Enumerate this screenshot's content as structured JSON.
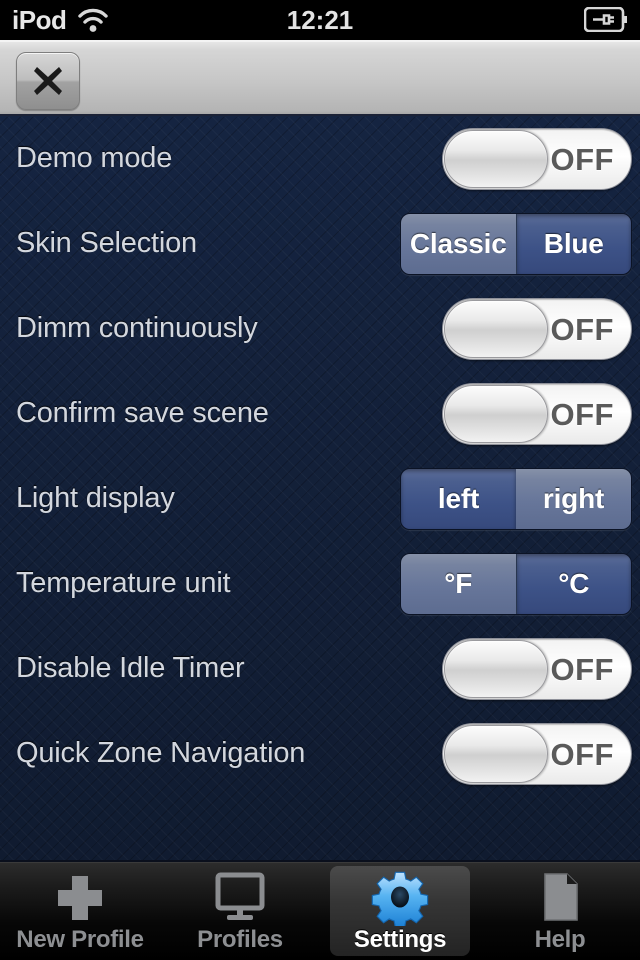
{
  "statusbar": {
    "carrier": "iPod",
    "wifi_icon": "wifi-icon",
    "time": "12:21",
    "battery_icon": "battery-charging-icon"
  },
  "toolbar": {
    "close_icon": "close-x-icon",
    "close_label": ""
  },
  "theme": {
    "background": "#142038",
    "accent_selected": "#3d5287",
    "accent_unselected": "#67769a",
    "label_color": "#d3d7de",
    "tab_selected_color": "#ffffff",
    "tab_icon_gear_color": "#3fa9f5"
  },
  "settings": {
    "rows": [
      {
        "label": "Demo mode",
        "control": "switch",
        "value": "OFF"
      },
      {
        "label": "Skin Selection",
        "control": "segmented",
        "options": [
          "Classic",
          "Blue"
        ],
        "selected": "Blue"
      },
      {
        "label": "Dimm continuously",
        "control": "switch",
        "value": "OFF"
      },
      {
        "label": "Confirm save scene",
        "control": "switch",
        "value": "OFF"
      },
      {
        "label": "Light display",
        "control": "segmented",
        "options": [
          "left",
          "right"
        ],
        "selected": "left"
      },
      {
        "label": "Temperature unit",
        "control": "segmented",
        "options": [
          "°F",
          "°C"
        ],
        "selected": "°C"
      },
      {
        "label": "Disable Idle Timer",
        "control": "switch",
        "value": "OFF"
      },
      {
        "label": "Quick Zone Navigation",
        "control": "switch",
        "value": "OFF"
      }
    ]
  },
  "tabbar": {
    "tabs": [
      {
        "label": "New Profile",
        "icon": "plus-icon",
        "selected": false
      },
      {
        "label": "Profiles",
        "icon": "monitor-icon",
        "selected": false
      },
      {
        "label": "Settings",
        "icon": "gear-icon",
        "selected": true
      },
      {
        "label": "Help",
        "icon": "document-icon",
        "selected": false
      }
    ]
  }
}
